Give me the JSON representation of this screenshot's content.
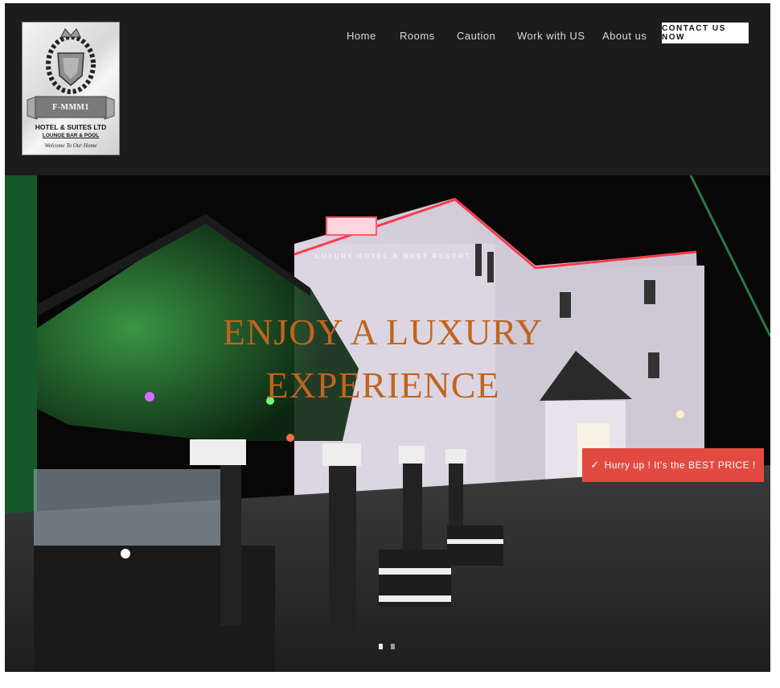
{
  "logo": {
    "name": "F-MMM1",
    "line2": "HOTEL & SUITES LTD",
    "line3": "LOUNGE BAR & POOL",
    "tagline": "Welcome To Our Home"
  },
  "nav": {
    "items": [
      {
        "label": "Home"
      },
      {
        "label": "Rooms"
      },
      {
        "label": "Caution"
      },
      {
        "label": "Work with US"
      },
      {
        "label": "About us"
      }
    ],
    "cta": "CONTACT US NOW"
  },
  "hero": {
    "kicker": "LUXURY HOTEL & BEST RESORT",
    "headline_line1": "ENJOY A LUXURY",
    "headline_line2": "EXPERIENCE",
    "promo": "Hurry up ! It's the BEST PRICE !",
    "promo_icon": "checkmark-icon",
    "slides": {
      "total": 2,
      "active": 1
    }
  },
  "colors": {
    "header_bg": "#1c1c1c",
    "headline": "#c0641f",
    "promo_bg": "#e24a41",
    "cta_bg": "#ffffff"
  }
}
